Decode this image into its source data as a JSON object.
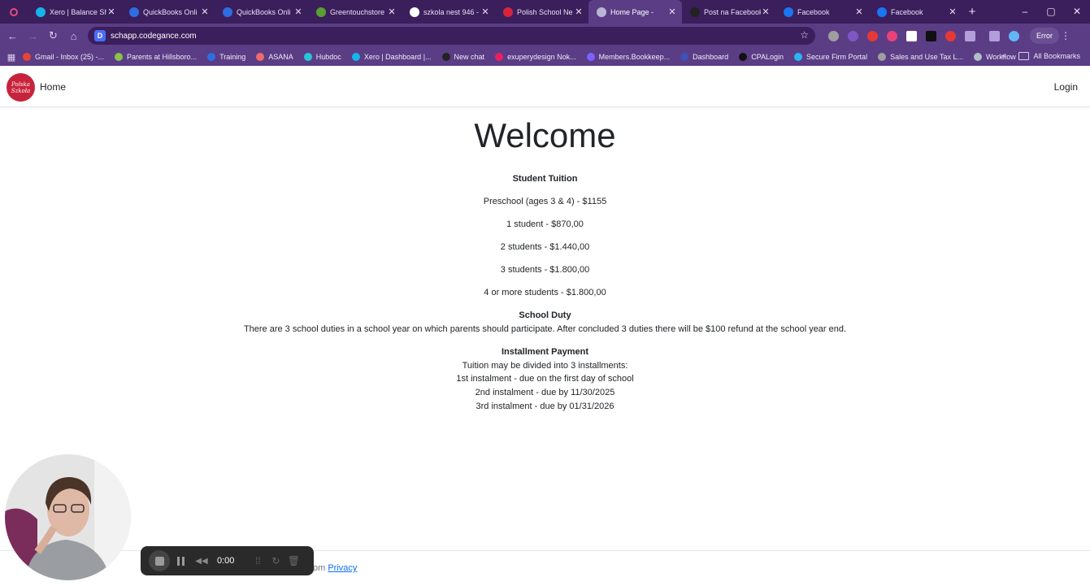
{
  "browser": {
    "tabs": [
      {
        "title": "Xero | Balance Sh",
        "favicon_color": "#13b5ea",
        "active": false
      },
      {
        "title": "QuickBooks Onli",
        "favicon_color": "#2d6fe0",
        "active": false
      },
      {
        "title": "QuickBooks Onli",
        "favicon_color": "#2d6fe0",
        "active": false
      },
      {
        "title": "Greentouchstore",
        "favicon_color": "#5a9e2f",
        "active": false
      },
      {
        "title": "szkola nest 946 -",
        "favicon_color": "#ffffff",
        "active": false
      },
      {
        "title": "Polish School Ne",
        "favicon_color": "#d9233c",
        "active": false
      },
      {
        "title": "Home Page -",
        "favicon_color": "#b9b5d4",
        "active": true
      },
      {
        "title": "Post na Facebook",
        "favicon_color": "#222222",
        "active": false
      },
      {
        "title": "Facebook",
        "favicon_color": "#1877f2",
        "active": false
      },
      {
        "title": "Facebook",
        "favicon_color": "#1877f2",
        "active": false
      }
    ],
    "url": "schapp.codegance.com",
    "error_label": "Error",
    "bookmarks": [
      {
        "label": "Gmail - Inbox (25) -...",
        "color": "#ea4335"
      },
      {
        "label": "Parents at Hillsboro...",
        "color": "#8bc34a"
      },
      {
        "label": "Training",
        "color": "#2d6fe0"
      },
      {
        "label": "ASANA",
        "color": "#f06a6a"
      },
      {
        "label": "Hubdoc",
        "color": "#26c6da"
      },
      {
        "label": "Xero | Dashboard |...",
        "color": "#13b5ea"
      },
      {
        "label": "New chat",
        "color": "#222222"
      },
      {
        "label": "exuperydesign Nok...",
        "color": "#e91e63"
      },
      {
        "label": "Members.Bookkeep...",
        "color": "#7b61ff"
      },
      {
        "label": "Dashboard",
        "color": "#3f51b5"
      },
      {
        "label": "CPALogin",
        "color": "#111111"
      },
      {
        "label": "Secure Firm Portal",
        "color": "#29b6f6"
      },
      {
        "label": "Sales and Use Tax L...",
        "color": "#9e9e9e"
      },
      {
        "label": "Workflow",
        "color": "#b0bec5"
      }
    ],
    "all_bookmarks_label": "All Bookmarks"
  },
  "navbar": {
    "home_label": "Home",
    "login_label": "Login",
    "logo_text": "Polska Szkoła"
  },
  "page": {
    "title": "Welcome",
    "tuition_heading": "Student Tuition",
    "tuition_items": [
      "Preschool (ages 3 & 4) - $1155",
      "1 student - $870,00",
      "2 students - $1.440,00",
      "3 students - $1.800,00",
      "4 or more students - $1.800,00"
    ],
    "duty_heading": "School Duty",
    "duty_text": "There are 3 school duties in a school year on which parents should participate. After concluded 3 duties there will be $100 refund at the school year end.",
    "installment_heading": "Installment Payment",
    "installment_lines": [
      "Tuition may be divided into 3 installments:",
      "1st instalment - due on the first day of school",
      "2nd instalment - due by 11/30/2025",
      "3rd instalment - due by 01/31/2026"
    ]
  },
  "footer": {
    "text": "om",
    "privacy_label": "Privacy"
  },
  "recorder": {
    "time": "0:00"
  }
}
